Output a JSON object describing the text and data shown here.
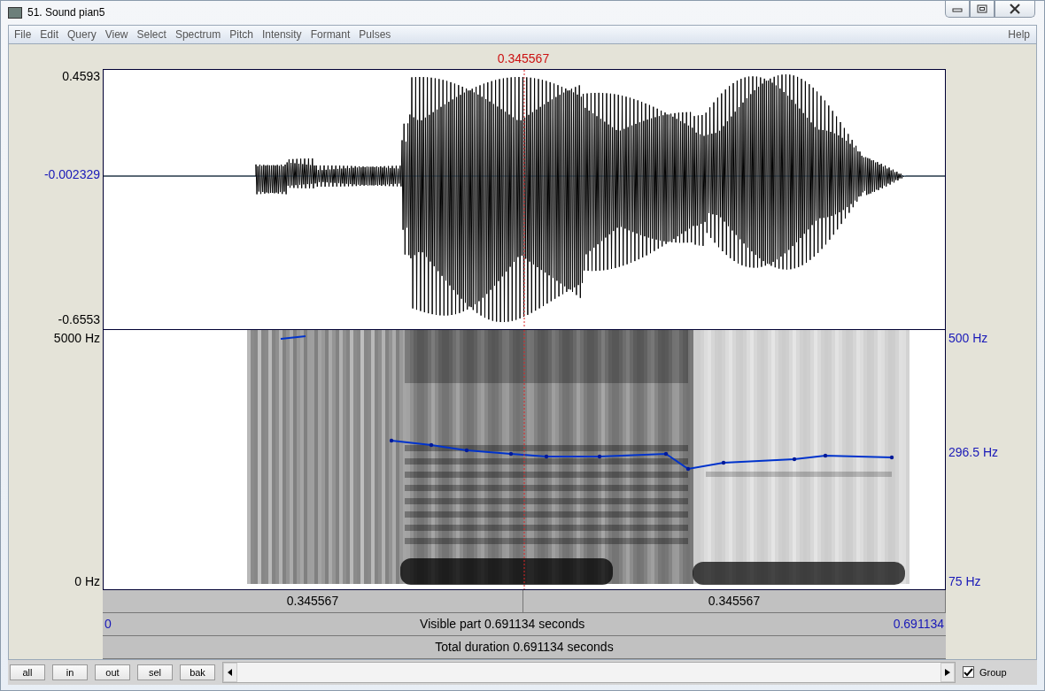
{
  "window": {
    "title": "51. Sound pian5"
  },
  "menu": [
    "File",
    "Edit",
    "Query",
    "View",
    "Select",
    "Spectrum",
    "Pitch",
    "Intensity",
    "Formant",
    "Pulses"
  ],
  "help_menu": "Help",
  "cursor": {
    "time": "0.345567"
  },
  "waveform": {
    "max": "0.4593",
    "zero": "-0.002329",
    "min": "-0.6553"
  },
  "spectrogram": {
    "top": "5000 Hz",
    "bottom": "0 Hz",
    "pitch_top": "500 Hz",
    "pitch_mid": "296.5 Hz",
    "pitch_bottom": "75 Hz"
  },
  "time_bars": {
    "left_segment": "0.345567",
    "right_segment": "0.345567",
    "start": "0",
    "visible": "Visible part 0.691134 seconds",
    "end": "0.691134",
    "total": "Total duration 0.691134 seconds"
  },
  "buttons": [
    "all",
    "in",
    "out",
    "sel",
    "bak"
  ],
  "group": {
    "label": "Group",
    "checked": true
  }
}
